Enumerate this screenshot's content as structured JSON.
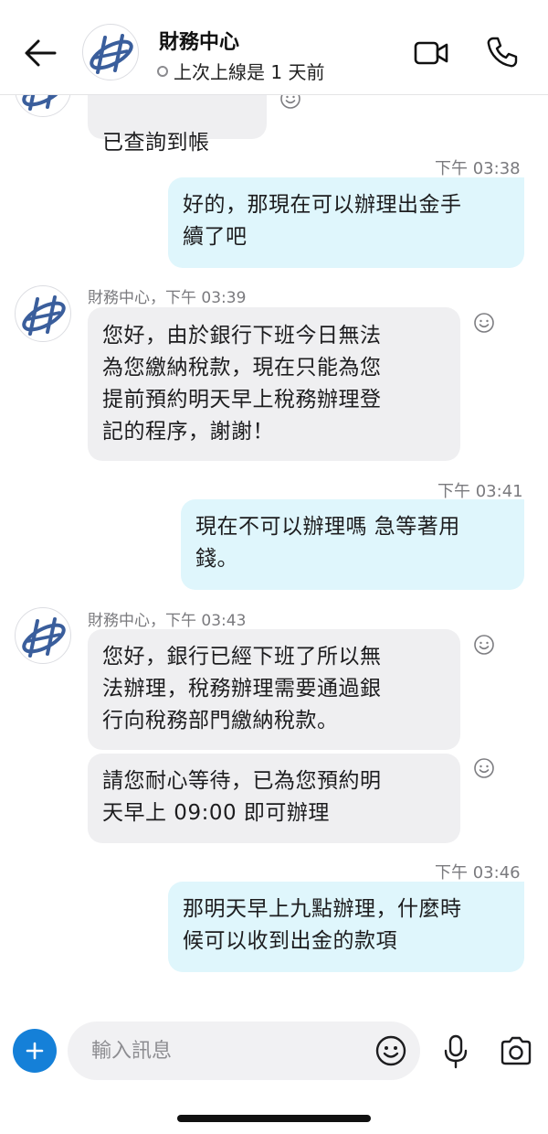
{
  "header": {
    "title": "財務中心",
    "status": "上次上線是 1 天前",
    "icons": [
      "back-arrow-icon",
      "logo-icon",
      "video-call-icon",
      "phone-icon"
    ]
  },
  "messages": {
    "partial": {
      "text": "已查詢到帳"
    },
    "m1": {
      "time": "下午 03:38",
      "text": "好的，那現在可以辦理出金手\n續了吧"
    },
    "m2": {
      "sender": "財務中心，下午 03:39",
      "text": "您好，由於銀行下班今日無法\n為您繳納稅款，現在只能為您\n提前預約明天早上稅務辦理登\n記的程序，謝謝！"
    },
    "m3": {
      "time": "下午 03:41",
      "text": "現在不可以辦理嗎  急等著用\n錢。"
    },
    "m4": {
      "sender": "財務中心，下午 03:43",
      "text": "您好，銀行已經下班了所以無\n法辦理，稅務辦理需要通過銀\n行向稅務部門繳納稅款。"
    },
    "m5": {
      "text": "請您耐心等待，已為您預約明\n天早上 09:00 即可辦理"
    },
    "m6": {
      "time": "下午 03:46",
      "text": "那明天早上九點辦理，什麼時\n候可以收到出金的款項"
    }
  },
  "composer": {
    "placeholder": "輸入訊息",
    "icons": [
      "plus-icon",
      "emoji-icon",
      "microphone-icon",
      "camera-icon"
    ]
  },
  "colors": {
    "outgoing_bubble": "#dff6fc",
    "incoming_bubble": "#efeff1",
    "accent": "#1580d8",
    "logo_blue": "#3a5e9c"
  }
}
